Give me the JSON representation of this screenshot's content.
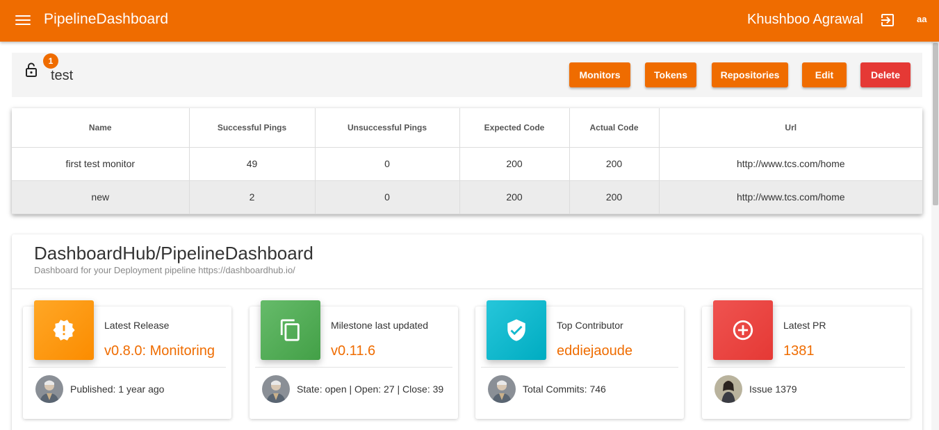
{
  "header": {
    "app_title": "PipelineDashboard",
    "user_name": "Khushboo Agrawal",
    "user_initials": "aa"
  },
  "project": {
    "name": "test",
    "badge_count": "1",
    "buttons": {
      "monitors": "Monitors",
      "tokens": "Tokens",
      "repositories": "Repositories",
      "edit": "Edit",
      "delete": "Delete"
    }
  },
  "monitors_table": {
    "columns": [
      "Name",
      "Successful Pings",
      "Unsuccessful Pings",
      "Expected Code",
      "Actual Code",
      "Url"
    ],
    "rows": [
      [
        "first test monitor",
        "49",
        "0",
        "200",
        "200",
        "http://www.tcs.com/home"
      ],
      [
        "new",
        "2",
        "0",
        "200",
        "200",
        "http://www.tcs.com/home"
      ]
    ]
  },
  "repository": {
    "title": "DashboardHub/PipelineDashboard",
    "description": "Dashboard for your Deployment pipeline https://dashboardhub.io/",
    "stats": [
      {
        "label": "Latest Release",
        "value": "v0.8.0: Monitoring",
        "footer": "Published: 1 year ago",
        "icon": "alert-badge-icon",
        "color": "#ff9800"
      },
      {
        "label": "Milestone last updated",
        "value": "v0.11.6",
        "footer": "State: open | Open: 27 | Close: 39",
        "icon": "copy-icon",
        "color": "#4caf50"
      },
      {
        "label": "Top Contributor",
        "value": "eddiejaoude",
        "footer": "Total Commits: 746",
        "icon": "verified-shield-icon",
        "color": "#00bcd4"
      },
      {
        "label": "Latest PR",
        "value": "1381",
        "footer": "Issue 1379",
        "icon": "add-circle-icon",
        "color": "#e53935"
      }
    ]
  },
  "colors": {
    "primary": "#ef6c00",
    "danger": "#e53935"
  }
}
